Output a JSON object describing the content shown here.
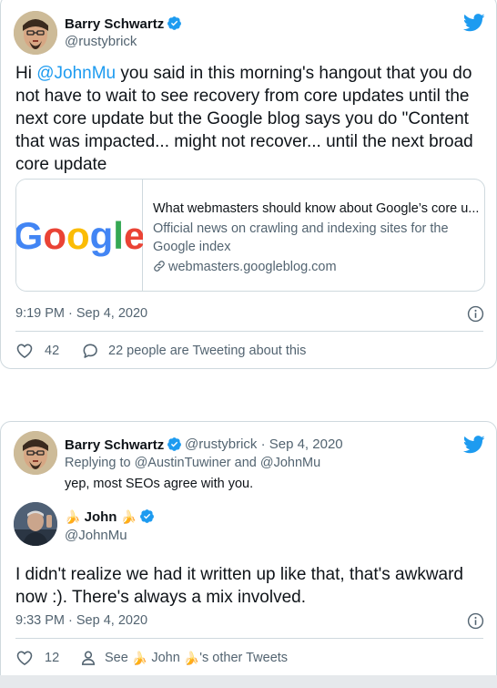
{
  "tweet1": {
    "author_name": "Barry Schwartz",
    "author_handle": "@rustybrick",
    "text_before": "Hi ",
    "mention": "@JohnMu",
    "text_after": " you said in this morning's hangout that you do not have to wait to see recovery from core updates until the next core update but the Google blog says you do \"Content that was impacted...  might not recover... until the next broad core update",
    "link_card": {
      "title": "What webmasters should know about Google’s core u...",
      "description": "Official news on crawling and indexing sites for the Google index",
      "domain": "webmasters.googleblog.com",
      "thumb_text": "Google"
    },
    "timestamp": "9:19 PM · Sep 4, 2020",
    "likes": "42",
    "conversation": "22 people are Tweeting about this"
  },
  "tweet2": {
    "parent_name": "Barry Schwartz",
    "parent_handle_date": "@rustybrick · Sep 4, 2020",
    "replying_to": "Replying to @AustinTuwiner and @JohnMu",
    "parent_text": "yep, most SEOs agree with you.",
    "author_name": "John",
    "author_handle": "@JohnMu",
    "text": "I didn't realize we had it written up like that, that's awkward now :). There's always a mix involved.",
    "timestamp": "9:33 PM · Sep 4, 2020",
    "likes": "12",
    "see_prefix": "See",
    "see_name": "John",
    "see_suffix": "'s other Tweets"
  },
  "icons": {
    "brand": "twitter-bird",
    "verified": "verified-badge",
    "like": "heart-outline",
    "conversation": "speech-bubble",
    "profile": "person-outline",
    "info": "info-circle",
    "link": "chain-link",
    "emoji": "🍌"
  },
  "colors": {
    "brand_blue": "#1d9bf0",
    "text": "#0f1419",
    "secondary": "#536471",
    "border": "#cfd9de"
  }
}
